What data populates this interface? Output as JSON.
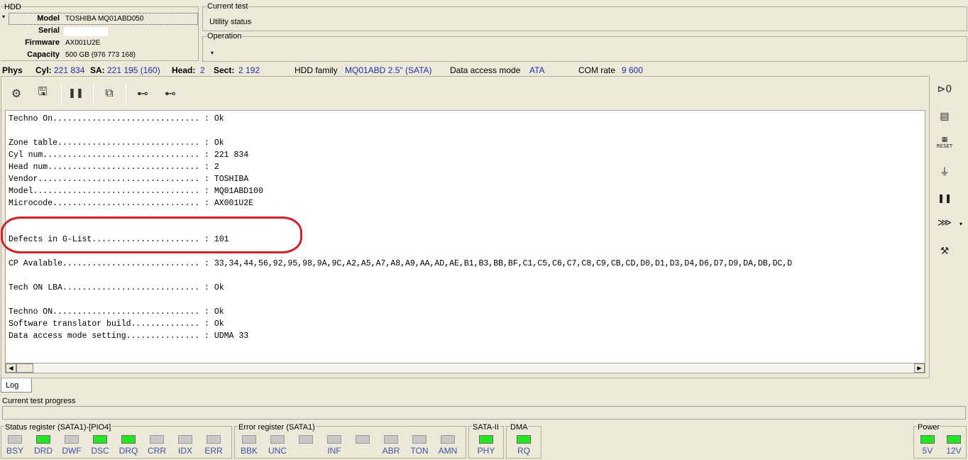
{
  "hdd_panel": {
    "title": "HDD",
    "fields": [
      {
        "label": "Model",
        "value": "TOSHIBA MQ01ABD050"
      },
      {
        "label": "Serial",
        "value": ""
      },
      {
        "label": "Firmware",
        "value": "AX001U2E"
      },
      {
        "label": "Capacity",
        "value": "500 GB (976 773 168)"
      }
    ]
  },
  "current_test": {
    "title": "Current test",
    "value": "Utility status"
  },
  "operation": {
    "title": "Operation"
  },
  "phys_bar": {
    "phys": "Phys",
    "cyl_label": "Cyl:",
    "cyl_value": "221 834",
    "sa_label": "SA:",
    "sa_value": "221 195 (160)",
    "head_label": "Head:",
    "head_value": "2",
    "sect_label": "Sect:",
    "sect_value": "2 192",
    "family_label": "HDD family",
    "family_value": "MQ01ABD 2.5\" (SATA)",
    "access_label": "Data access mode",
    "access_value": "ATA",
    "com_label": "COM rate",
    "com_value": "9 600"
  },
  "toolbar": {
    "icons": [
      "settings-chip-icon",
      "save-drive-icon",
      "pause-icon",
      "copy-pages-icon",
      "binoculars-icon",
      "binoculars-dots-icon"
    ]
  },
  "right_toolbar": {
    "icons": [
      "power-cycle-icon",
      "board-icon",
      "reset-icon",
      "probe-icon",
      "pause-icon",
      "slider-icon",
      "tools-icon"
    ],
    "reset_label": "RESET"
  },
  "log_lines": [
    "Techno On.............................. : Ok",
    "",
    "Zone table............................. : Ok",
    "Cyl num................................ : 221 834",
    "Head num............................... : 2",
    "Vendor................................. : TOSHIBA",
    "Model.................................. : MQ01ABD100",
    "Microcode.............................. : AX001U2E",
    "",
    "",
    "Defects in G-List...................... : 101",
    "",
    "CP Avalable............................ : 33,34,44,56,92,95,98,9A,9C,A2,A5,A7,A8,A9,AA,AD,AE,B1,B3,BB,BF,C1,C5,C6,C7,C8,C9,CB,CD,D0,D1,D3,D4,D6,D7,D9,DA,DB,DC,D",
    "",
    "Tech ON LBA............................ : Ok",
    "",
    "Techno ON.............................. : Ok",
    "Software translator build.............. : Ok",
    "Data access mode setting............... : UDMA 33"
  ],
  "log_tab": "Log",
  "progress": {
    "label": "Current test progress",
    "value": 0
  },
  "status_register": {
    "title": "Status register (SATA1)-[PIO4]",
    "leds": [
      {
        "label": "BSY",
        "on": false
      },
      {
        "label": "DRD",
        "on": true
      },
      {
        "label": "DWF",
        "on": false
      },
      {
        "label": "DSC",
        "on": true
      },
      {
        "label": "DRQ",
        "on": true
      },
      {
        "label": "CRR",
        "on": false
      },
      {
        "label": "IDX",
        "on": false
      },
      {
        "label": "ERR",
        "on": false
      }
    ]
  },
  "error_register": {
    "title": "Error register (SATA1)",
    "leds": [
      {
        "label": "BBK",
        "on": false
      },
      {
        "label": "UNC",
        "on": false
      },
      {
        "label": "",
        "on": false
      },
      {
        "label": "INF",
        "on": false
      },
      {
        "label": "",
        "on": false
      },
      {
        "label": "ABR",
        "on": false
      },
      {
        "label": "TON",
        "on": false
      },
      {
        "label": "AMN",
        "on": false
      }
    ]
  },
  "sata": {
    "title": "SATA-II",
    "leds": [
      {
        "label": "PHY",
        "on": true
      }
    ]
  },
  "dma": {
    "title": "DMA",
    "leds": [
      {
        "label": "RQ",
        "on": true
      }
    ]
  },
  "power": {
    "title": "Power",
    "leds": [
      {
        "label": "5V",
        "on": true
      },
      {
        "label": "12V",
        "on": true
      }
    ]
  },
  "colors": {
    "led_on": "#22e622",
    "led_off": "#c8c8c8",
    "value_blue": "#1c2fb0",
    "highlight": "#d0222b"
  }
}
